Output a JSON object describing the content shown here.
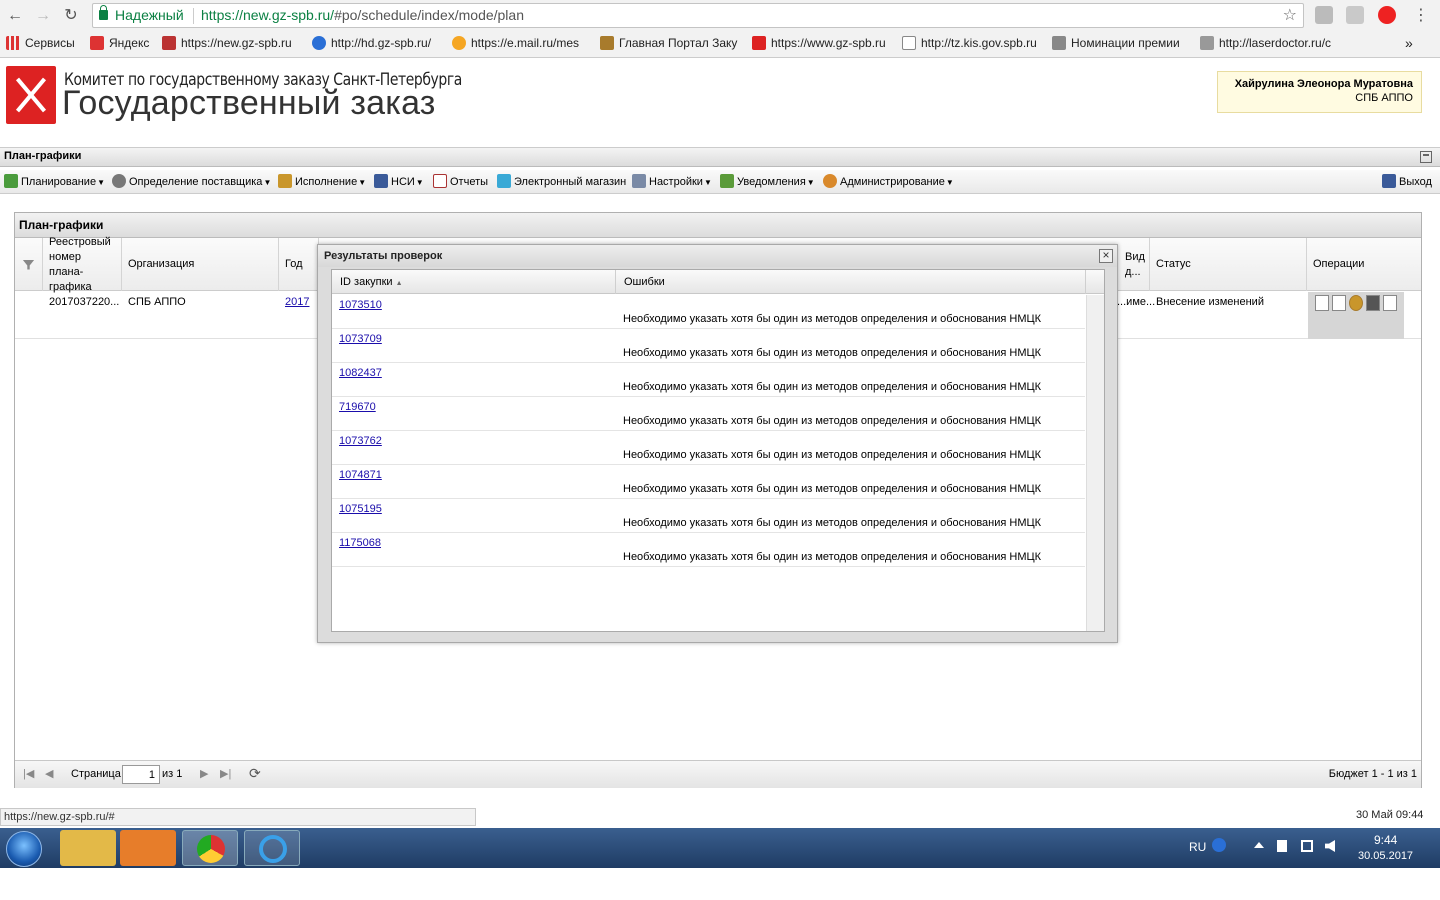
{
  "browser": {
    "secure_label": "Надежный",
    "url_host": "https://new.gz-spb.ru/",
    "url_path": "#po/schedule/index/mode/plan",
    "bookmarks": [
      "Сервисы",
      "Яндекс",
      "https://new.gz-spb.ru",
      "http://hd.gz-spb.ru/",
      "https://e.mail.ru/mes",
      "Главная Портал Заку",
      "https://www.gz-spb.ru",
      "http://tz.kis.gov.spb.ru",
      "Номинации премии",
      "http://laserdoctor.ru/c"
    ],
    "more": "»"
  },
  "header": {
    "subtitle": "Комитет по государственному заказу Санкт-Петербурга",
    "title": "Государственный заказ",
    "user_name": "Хайрулина Элеонора Муратовна",
    "user_org": "СПБ АППО"
  },
  "section_title": "План-графики",
  "menu": {
    "items": [
      "Планирование",
      "Определение поставщика",
      "Исполнение",
      "НСИ",
      "Отчеты",
      "Электронный магазин",
      "Настройки",
      "Уведомления",
      "Администрирование"
    ],
    "exit": "Выход"
  },
  "grid": {
    "title": "План-графики",
    "columns": [
      "Реестровый номер плана-графика",
      "Организация",
      "Год",
      "...",
      "Вид д...",
      "Статус",
      "Операции"
    ],
    "rows": [
      {
        "number": "2017037220...",
        "org": "СПБ АППО",
        "year": "2017",
        "partial": "...име...",
        "status": "Внесение изменений"
      }
    ]
  },
  "pager": {
    "page_label": "Страница",
    "page_value": "1",
    "of_label": "из 1",
    "summary": "Бюджет 1 - 1 из 1"
  },
  "modal": {
    "title": "Результаты проверок",
    "close": "×",
    "columns": [
      "ID закупки",
      "Ошибки"
    ],
    "sort_indicator": "▲",
    "rows": [
      {
        "id": "1073510",
        "error": "Необходимо указать хотя бы один из методов определения и обоснования НМЦК"
      },
      {
        "id": "1073709",
        "error": "Необходимо указать хотя бы один из методов определения и обоснования НМЦК"
      },
      {
        "id": "1082437",
        "error": "Необходимо указать хотя бы один из методов определения и обоснования НМЦК"
      },
      {
        "id": "719670",
        "error": "Необходимо указать хотя бы один из методов определения и обоснования НМЦК"
      },
      {
        "id": "1073762",
        "error": "Необходимо указать хотя бы один из методов определения и обоснования НМЦК"
      },
      {
        "id": "1074871",
        "error": "Необходимо указать хотя бы один из методов определения и обоснования НМЦК"
      },
      {
        "id": "1075195",
        "error": "Необходимо указать хотя бы один из методов определения и обоснования НМЦК"
      },
      {
        "id": "1175068",
        "error": "Необходимо указать хотя бы один из методов определения и обоснования НМЦК"
      }
    ]
  },
  "status_bar": {
    "url": "https://new.gz-spb.ru/#",
    "datetime": "30 Май 09:44"
  },
  "taskbar": {
    "lang": "RU",
    "time": "9:44",
    "date": "30.05.2017"
  },
  "icons": {
    "back": "←",
    "forward": "→",
    "reload": "↻",
    "star": "☆",
    "menu": "⋮",
    "first": "|◀",
    "prev": "◀",
    "next": "▶",
    "last": "▶|",
    "refresh": "⟳"
  },
  "colors": {
    "link": "#1a0dab",
    "secure": "#0b8043",
    "brand_red": "#d22222"
  }
}
